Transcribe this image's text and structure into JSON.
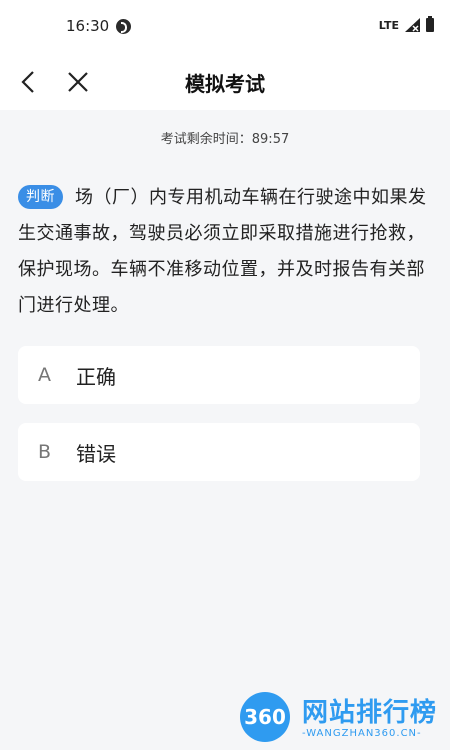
{
  "status": {
    "time": "16:30",
    "network": "LTE"
  },
  "nav": {
    "title": "模拟考试",
    "back_icon": "chevron-left-icon",
    "close_icon": "close-icon"
  },
  "timer": {
    "text": "考试剩余时间：89:57"
  },
  "question": {
    "type_tag": "判断",
    "text": "场（厂）内专用机动车辆在行驶途中如果发生交通事故，驾驶员必须立即采取措施进行抢救，保护现场。车辆不准移动位置，并及时报告有关部门进行处理。"
  },
  "options": [
    {
      "letter": "A",
      "text": "正确"
    },
    {
      "letter": "B",
      "text": "错误"
    }
  ],
  "watermark": {
    "logo": "360",
    "title": "网站排行榜",
    "subtitle": "-WANGZHAN360.CN-"
  },
  "colors": {
    "accent": "#3a8ee6",
    "background": "#f5f6f8"
  }
}
